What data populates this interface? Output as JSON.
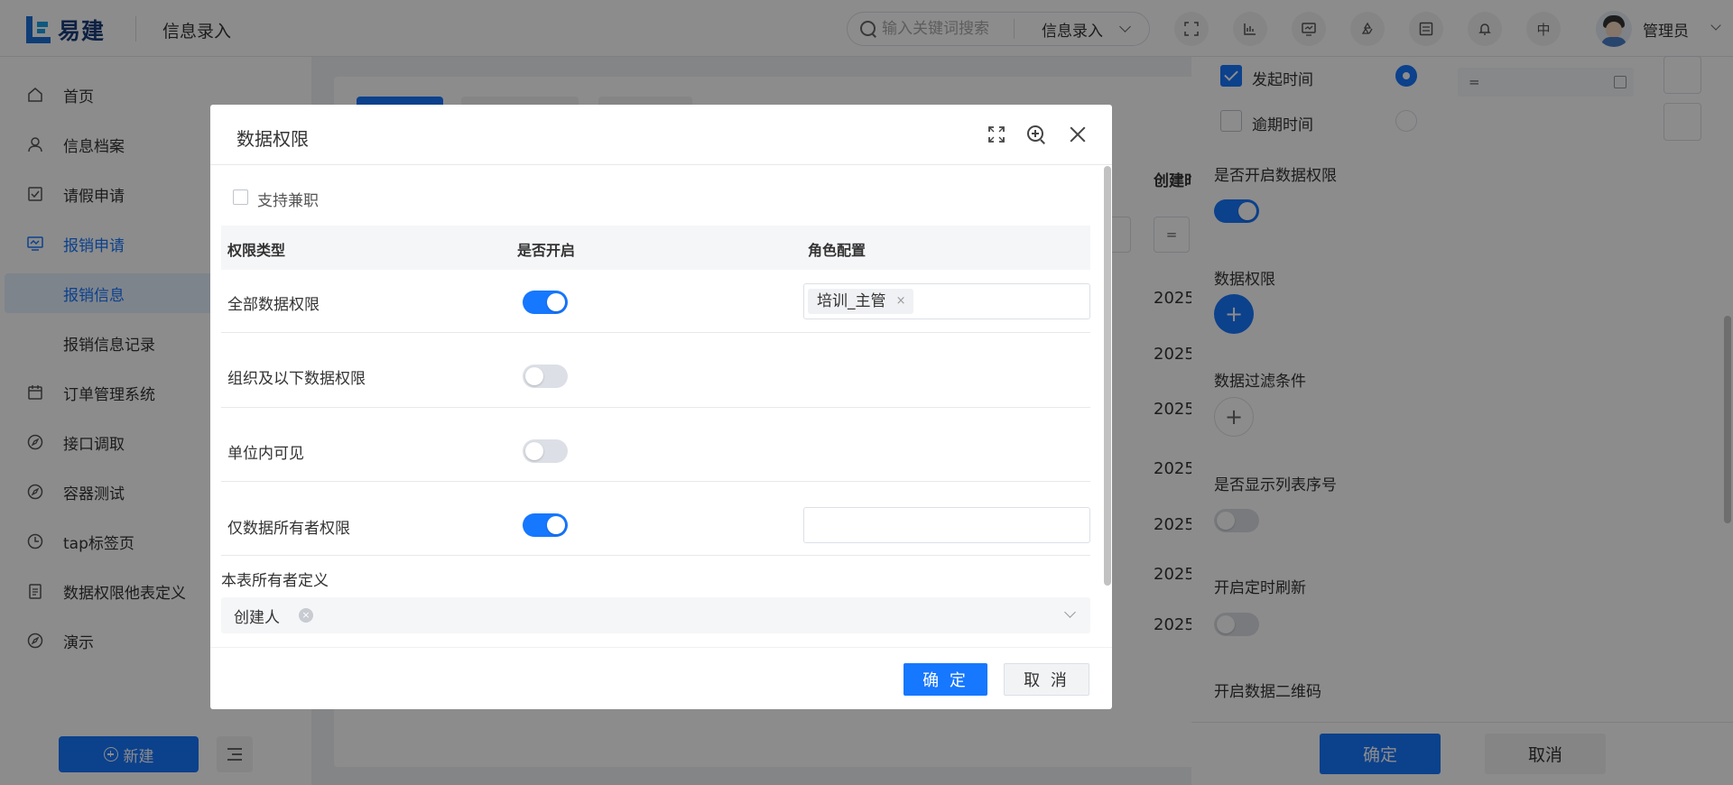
{
  "app": {
    "logo_text": "易建",
    "page_title": "信息录入"
  },
  "search": {
    "placeholder": "输入关键词搜索",
    "scope": "信息录入"
  },
  "header": {
    "lang": "中",
    "user_name": "管理员"
  },
  "sidebar": {
    "items": [
      {
        "label": "首页",
        "icon": "home-icon"
      },
      {
        "label": "信息档案",
        "icon": "user-icon"
      },
      {
        "label": "请假申请",
        "icon": "checklist-icon"
      },
      {
        "label": "报销申请",
        "icon": "monitor-icon"
      },
      {
        "label": "报销信息",
        "icon": ""
      },
      {
        "label": "报销信息记录",
        "icon": ""
      },
      {
        "label": "订单管理系统",
        "icon": "calendar-icon"
      },
      {
        "label": "接口调取",
        "icon": "compass-icon"
      },
      {
        "label": "容器测试",
        "icon": "compass-icon"
      },
      {
        "label": "tap标签页",
        "icon": "clock-icon"
      },
      {
        "label": "数据权限他表定义",
        "icon": "clipboard-icon"
      },
      {
        "label": "演示",
        "icon": "compass-icon"
      }
    ],
    "new_button": "新建"
  },
  "background_table": {
    "header_partial": "创建时",
    "filter_symbol": "=",
    "cell_prefix": "2025"
  },
  "drawer": {
    "options": [
      {
        "label": "发起时间",
        "checked": true,
        "radio": true
      },
      {
        "label": "逾期时间",
        "checked": false,
        "radio": false
      }
    ],
    "input_value": "=",
    "sections": {
      "enable_data_permission": "是否开启数据权限",
      "data_permission": "数据权限",
      "data_filter": "数据过滤条件",
      "show_row_number": "是否显示列表序号",
      "timed_refresh": "开启定时刷新",
      "data_qrcode": "开启数据二维码"
    },
    "toggles": {
      "enable_data_permission": true,
      "show_row_number": false,
      "timed_refresh": false
    },
    "ok_label": "确定",
    "cancel_label": "取消"
  },
  "modal": {
    "title": "数据权限",
    "support_concurrent": "支持兼职",
    "columns": [
      "权限类型",
      "是否开启",
      "角色配置"
    ],
    "rows": [
      {
        "type": "全部数据权限",
        "enabled": true,
        "roles": [
          "培训_主管"
        ],
        "show_input": true
      },
      {
        "type": "组织及以下数据权限",
        "enabled": false,
        "roles": [],
        "show_input": false
      },
      {
        "type": "单位内可见",
        "enabled": false,
        "roles": [],
        "show_input": false
      },
      {
        "type": "仅数据所有者权限",
        "enabled": true,
        "roles": [],
        "show_input": true
      }
    ],
    "owner_label": "本表所有者定义",
    "owner_value": "创建人",
    "ok_label": "确 定",
    "cancel_label": "取 消"
  },
  "colors": {
    "primary": "#1677ff",
    "overlay": "rgba(0,0,0,0.45)"
  }
}
